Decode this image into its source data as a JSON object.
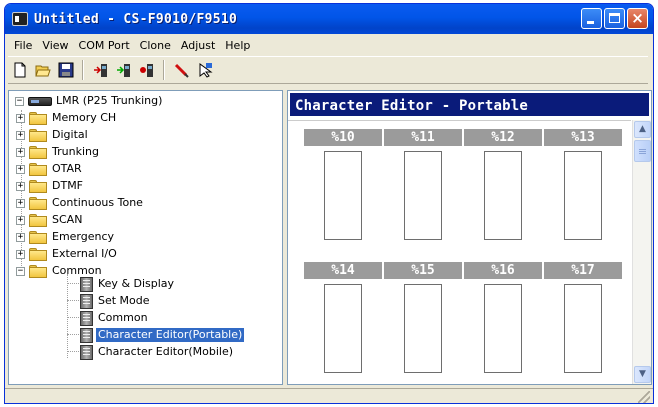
{
  "window": {
    "title": "Untitled - CS-F9010/F9510",
    "buttons": {
      "minimize": "minimize",
      "maximize": "maximize",
      "close": "×"
    }
  },
  "menu": [
    "File",
    "View",
    "COM Port",
    "Clone",
    "Adjust",
    "Help"
  ],
  "toolbar": {
    "groups": [
      [
        "new-file-icon",
        "open-folder-icon",
        "save-icon"
      ],
      [
        "read-radio-icon",
        "write-radio-icon",
        "radio-info-icon"
      ],
      [
        "tool-icon",
        "clone-icon"
      ]
    ]
  },
  "tree": {
    "root": "LMR (P25 Trunking)",
    "folders": [
      "Memory CH",
      "Digital",
      "Trunking",
      "OTAR",
      "DTMF",
      "Continuous Tone",
      "SCAN",
      "Emergency",
      "External I/O",
      "Common"
    ],
    "common_children": [
      "Key & Display",
      "Set Mode",
      "Common",
      "Character Editor(Portable)",
      "Character Editor(Mobile)"
    ],
    "selected": "Character Editor(Portable)",
    "expanded": "Common"
  },
  "editor": {
    "title": "Character Editor - Portable",
    "rows": [
      [
        "%10",
        "%11",
        "%12",
        "%13"
      ],
      [
        "%14",
        "%15",
        "%16",
        "%17"
      ]
    ]
  },
  "colors": {
    "title_bar": "#0155e8",
    "editor_header": "#0a1b7a",
    "cell_header": "#9b9b9b",
    "selection": "#316ac5"
  }
}
